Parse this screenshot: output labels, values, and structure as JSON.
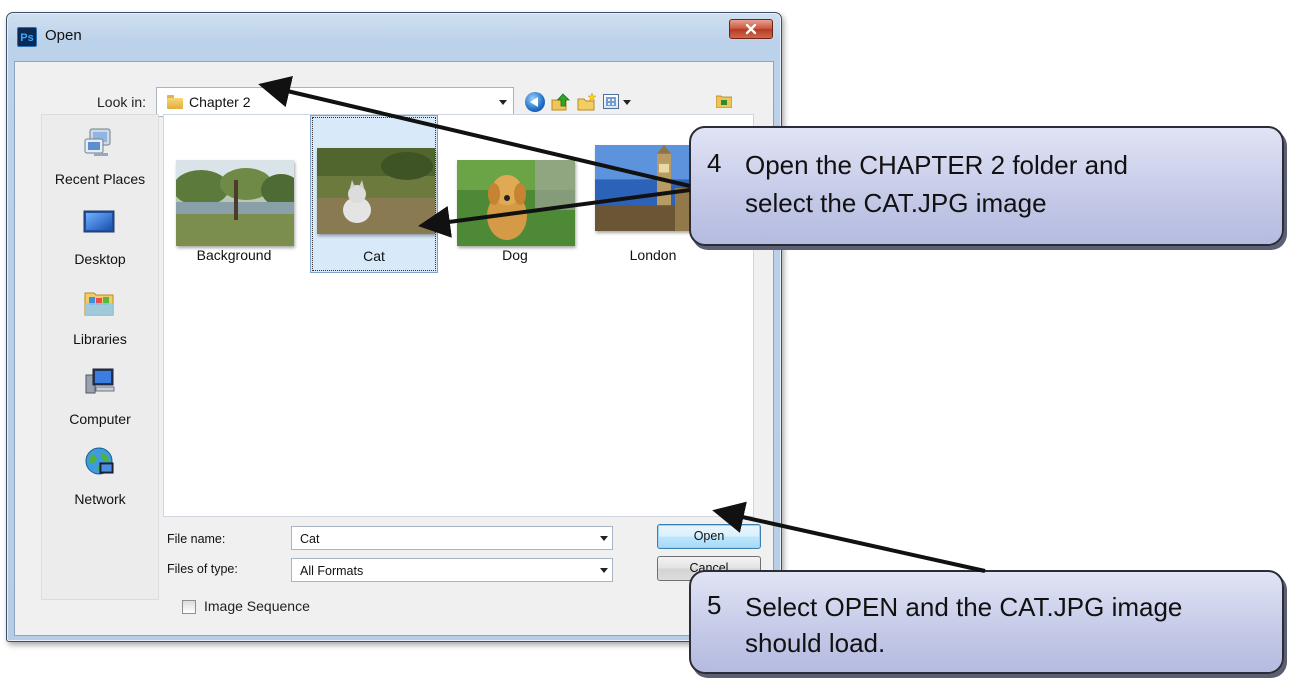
{
  "window": {
    "title": "Open",
    "app_icon": "photoshop-icon"
  },
  "look_in": {
    "label": "Look in:",
    "value": "Chapter 2"
  },
  "toolbar": {
    "icons": [
      "back-icon",
      "up-folder-icon",
      "new-folder-icon",
      "views-menu-icon",
      "browse-icon"
    ]
  },
  "places": [
    {
      "label": "Recent Places",
      "icon": "recent-places-icon"
    },
    {
      "label": "Desktop",
      "icon": "desktop-icon"
    },
    {
      "label": "Libraries",
      "icon": "libraries-icon"
    },
    {
      "label": "Computer",
      "icon": "computer-icon"
    },
    {
      "label": "Network",
      "icon": "network-icon"
    }
  ],
  "files": [
    {
      "name": "Background",
      "selected": false
    },
    {
      "name": "Cat",
      "selected": true
    },
    {
      "name": "Dog",
      "selected": false
    },
    {
      "name": "London",
      "selected": false
    }
  ],
  "file_name": {
    "label": "File name:",
    "value": "Cat"
  },
  "file_type": {
    "label": "Files of type:",
    "value": "All Formats"
  },
  "buttons": {
    "open": "Open",
    "cancel": "Cancel"
  },
  "image_sequence": {
    "label": "Image Sequence",
    "checked": false
  },
  "callouts": [
    {
      "number": "4",
      "line1": "Open the CHAPTER 2 folder and",
      "line2": "select the CAT.JPG image"
    },
    {
      "number": "5",
      "line1": "Select OPEN and the CAT.JPG image",
      "line2": "should load."
    }
  ],
  "colors": {
    "selection": "#d8eaf9",
    "callout_fill": "#c4c9e7",
    "arrow": "#111111"
  }
}
